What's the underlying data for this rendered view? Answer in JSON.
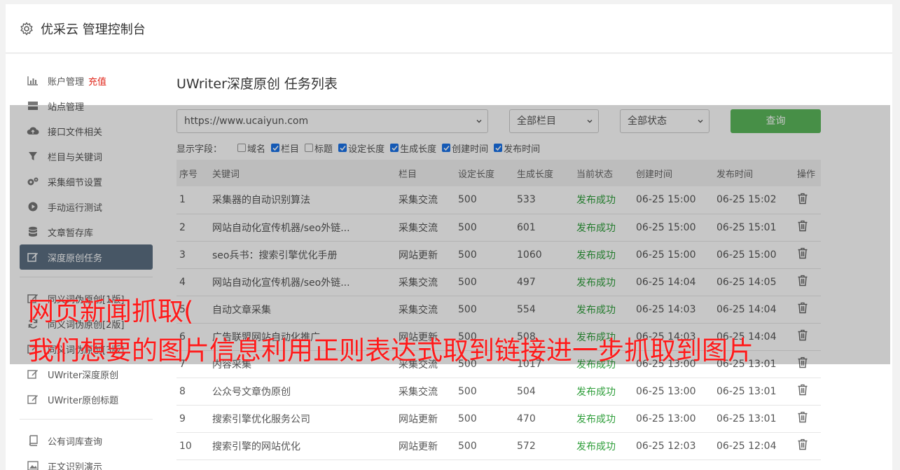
{
  "header": {
    "title": "优采云 管理控制台",
    "icon": "gear-icon"
  },
  "sidebar": {
    "items": [
      {
        "label": "账户管理",
        "badge": "充值",
        "icon": "bar-chart-icon"
      },
      {
        "label": "站点管理",
        "icon": "server-icon"
      },
      {
        "label": "接口文件相关",
        "icon": "cloud-upload-icon"
      },
      {
        "label": "栏目与关键词",
        "icon": "filter-icon"
      },
      {
        "label": "采集细节设置",
        "icon": "gears-icon"
      },
      {
        "label": "手动运行测试",
        "icon": "play-icon"
      },
      {
        "label": "文章暂存库",
        "icon": "database-icon"
      },
      {
        "label": "深度原创任务",
        "icon": "edit-icon",
        "active": true
      },
      {
        "label": "同义词伪原创[1版]",
        "icon": "edit-icon"
      },
      {
        "label": "同义词伪原创[2版]",
        "icon": "refresh-icon"
      },
      {
        "label": "同义词伪原创[3版]",
        "icon": "edit-icon"
      },
      {
        "label": "UWriter深度原创",
        "icon": "edit-icon"
      },
      {
        "label": "UWriter原创标题",
        "icon": "edit-icon"
      },
      {
        "label": "公有词库查询",
        "icon": "book-icon"
      },
      {
        "label": "正文识别演示",
        "icon": "image-icon"
      }
    ]
  },
  "main": {
    "title": "UWriter深度原创 任务列表",
    "site_select": "https://www.ucaiyun.com",
    "column_select": "全部栏目",
    "status_select": "全部状态",
    "query_label": "查询",
    "fields_label": "显示字段：",
    "fields": [
      {
        "label": "域名",
        "checked": false
      },
      {
        "label": "栏目",
        "checked": true
      },
      {
        "label": "标题",
        "checked": false
      },
      {
        "label": "设定长度",
        "checked": true
      },
      {
        "label": "生成长度",
        "checked": true
      },
      {
        "label": "创建时间",
        "checked": true
      },
      {
        "label": "发布时间",
        "checked": true
      }
    ],
    "columns": [
      "序号",
      "关键词",
      "栏目",
      "设定长度",
      "生成长度",
      "当前状态",
      "创建时间",
      "发布时间",
      "操作"
    ],
    "rows": [
      [
        "1",
        "采集器的自动识别算法",
        "采集交流",
        "500",
        "533",
        "发布成功",
        "06-25 15:00",
        "06-25 15:02"
      ],
      [
        "2",
        "网站自动化宣传机器/seo外链...",
        "采集交流",
        "500",
        "601",
        "发布成功",
        "06-25 15:00",
        "06-25 15:01"
      ],
      [
        "3",
        "seo兵书：搜索引擎优化手册",
        "网站更新",
        "500",
        "1060",
        "发布成功",
        "06-25 15:00",
        "06-25 15:00"
      ],
      [
        "4",
        "网站自动化宣传机器/seo外链...",
        "采集交流",
        "500",
        "497",
        "发布成功",
        "06-25 14:04",
        "06-25 14:05"
      ],
      [
        "5",
        "自动文章采集",
        "采集交流",
        "500",
        "554",
        "发布成功",
        "06-25 14:03",
        "06-25 14:04"
      ],
      [
        "6",
        "广告联盟网站自动化推广",
        "网站更新",
        "500",
        "508",
        "发布成功",
        "06-25 14:03",
        "06-25 14:04"
      ],
      [
        "7",
        "内容采集",
        "采集交流",
        "500",
        "1017",
        "发布成功",
        "06-25 13:00",
        "06-25 13:01"
      ],
      [
        "8",
        "公众号文章伪原创",
        "采集交流",
        "500",
        "504",
        "发布成功",
        "06-25 13:00",
        "06-25 13:01"
      ],
      [
        "9",
        "搜索引擎优化服务公司",
        "网站更新",
        "500",
        "470",
        "发布成功",
        "06-25 13:00",
        "06-25 13:01"
      ],
      [
        "10",
        "搜索引擎的网站优化",
        "网站更新",
        "500",
        "572",
        "发布成功",
        "06-25 12:03",
        "06-25 12:04"
      ]
    ]
  },
  "overlay": {
    "line1": "网页新闻抓取(",
    "line2": "我们想要的图片信息利用正则表达式取到链接进一步抓取到图片"
  },
  "colors": {
    "accent": "#5cb85c",
    "active_item": "#5b6f82",
    "success": "#2e9e3a",
    "badge": "#e0261a",
    "caption": "#ff1a1a"
  }
}
